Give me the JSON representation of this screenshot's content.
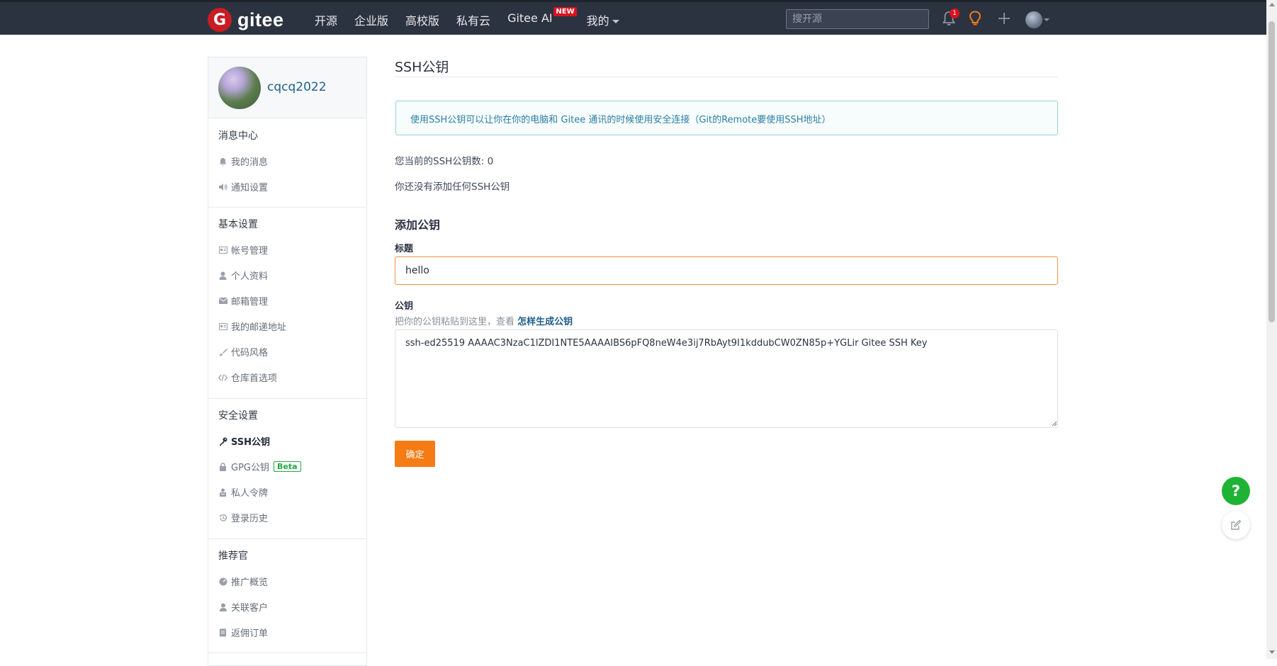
{
  "brand": {
    "logo_letter": "G",
    "name": "gitee"
  },
  "nav": {
    "links": [
      "开源",
      "企业版",
      "高校版",
      "私有云",
      "Gitee AI"
    ],
    "ai_badge": "NEW",
    "mine": "我的",
    "search_placeholder": "搜开源",
    "notification_count": "1"
  },
  "profile": {
    "username": "cqcq2022"
  },
  "sidebar": {
    "sections": {
      "messages": "消息中心",
      "basic": "基本设置",
      "security": "安全设置",
      "referrer": "推荐官"
    },
    "items": {
      "my_messages": "我的消息",
      "notify_settings": "通知设置",
      "account": "帐号管理",
      "personal": "个人资料",
      "email": "邮箱管理",
      "address": "我的邮递地址",
      "code_style": "代码风格",
      "repo_prefs": "仓库首选项",
      "ssh": "SSH公钥",
      "gpg": "GPG公钥",
      "gpg_badge": "Beta",
      "token": "私人令牌",
      "login_history": "登录历史",
      "promo_overview": "推广概览",
      "linked_clients": "关联客户",
      "commission_orders": "返佣订单"
    }
  },
  "main": {
    "title": "SSH公钥",
    "info": "使用SSH公钥可以让你在你的电脑和 Gitee 通讯的时候使用安全连接（Git的Remote要使用SSH地址）",
    "count_text": "您当前的SSH公钥数: 0",
    "empty_text": "你还没有添加任何SSH公钥",
    "add_title": "添加公钥",
    "title_label": "标题",
    "title_value": "hello",
    "key_label": "公钥",
    "helper_text": "把你的公钥粘贴到这里，查看 ",
    "helper_link": "怎样生成公钥",
    "key_value": "ssh-ed25519 AAAAC3NzaC1lZDI1NTE5AAAAIBS6pFQ8neW4e3ij7RbAyt9I1kddubCW0ZN85p+YGLir Gitee SSH Key",
    "confirm": "确定"
  },
  "floating": {
    "help": "?"
  },
  "colors": {
    "nav_bg": "#2c3340",
    "accent": "#f57b14",
    "brand": "#c71d23",
    "help_green": "#1fb335",
    "link": "#1f5f8a"
  },
  "icons": [
    "bell-icon",
    "lightbulb-icon",
    "plus-icon",
    "caret-down-icon",
    "key-icon",
    "lock-icon",
    "edit-icon"
  ]
}
